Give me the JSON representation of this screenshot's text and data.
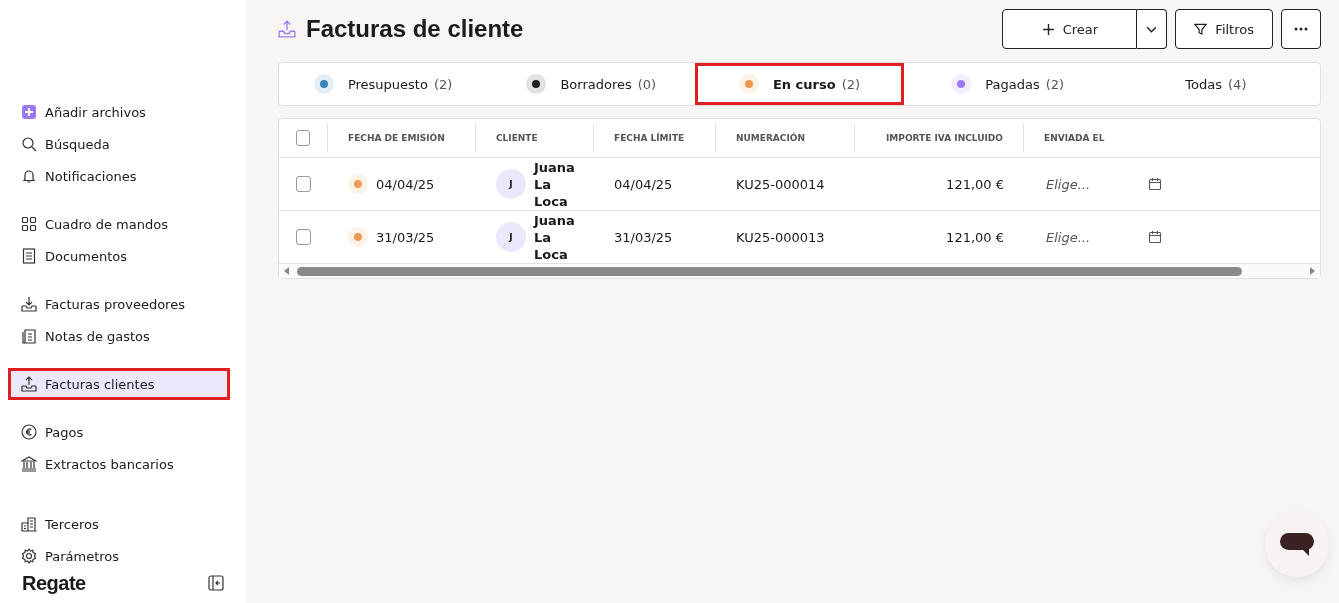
{
  "sidebar": {
    "items": [
      {
        "label": "Añadir archivos",
        "selected": false
      },
      {
        "label": "Búsqueda",
        "selected": false
      },
      {
        "label": "Notificaciones",
        "selected": false
      },
      {
        "label": "Cuadro de mandos",
        "selected": false
      },
      {
        "label": "Documentos",
        "selected": false
      },
      {
        "label": "Facturas proveedores",
        "selected": false
      },
      {
        "label": "Notas de gastos",
        "selected": false
      },
      {
        "label": "Facturas clientes",
        "selected": true
      },
      {
        "label": "Pagos",
        "selected": false
      },
      {
        "label": "Extractos bancarios",
        "selected": false
      },
      {
        "label": "Terceros",
        "selected": false
      },
      {
        "label": "Parámetros",
        "selected": false
      }
    ],
    "logo": "Regate"
  },
  "page": {
    "title": "Facturas de cliente",
    "buttons": {
      "create": "Crear",
      "filters": "Filtros"
    }
  },
  "tabs": [
    {
      "label": "Presupuesto",
      "count": "(2)",
      "color": "#3b82b8",
      "selected": false
    },
    {
      "label": "Borradores",
      "count": "(0)",
      "color": "#1f1f1f",
      "selected": false
    },
    {
      "label": "En curso",
      "count": "(2)",
      "color": "#ee9a52",
      "selected": true
    },
    {
      "label": "Pagadas",
      "count": "(2)",
      "color": "#9b7cf0",
      "selected": false
    },
    {
      "label": "Todas",
      "count": "(4)",
      "selected": false
    }
  ],
  "table": {
    "select_all_checked": false,
    "columns": [
      "FECHA DE EMISIÓN",
      "CLIENTE",
      "FECHA LÍMITE",
      "NUMERACIÓN",
      "IMPORTE IVA INCLUIDO",
      "ENVIADA EL"
    ],
    "rows": [
      {
        "checked": false,
        "color": "#ee9a52",
        "issued": "04/04/25",
        "initial": "J",
        "client": "Juana La Loca",
        "due": "04/04/25",
        "number": "KU25-000014",
        "amount": "121,00 €",
        "sent_placeholder": "Elige..."
      },
      {
        "checked": false,
        "color": "#ee9a52",
        "issued": "31/03/25",
        "initial": "J",
        "client": "Juana La Loca",
        "due": "31/03/25",
        "number": "KU25-000013",
        "amount": "121,00 €",
        "sent_placeholder": "Elige..."
      }
    ]
  }
}
